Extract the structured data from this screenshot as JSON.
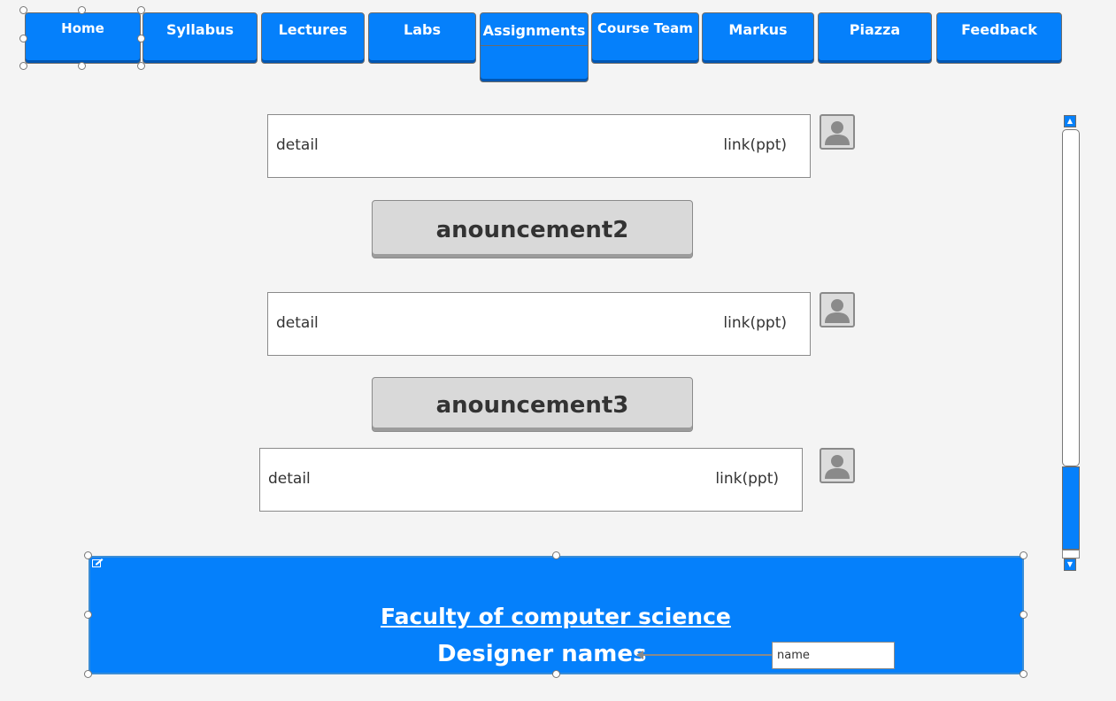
{
  "nav": {
    "items": [
      {
        "label": "Home"
      },
      {
        "label": "Syllabus"
      },
      {
        "label": "Lectures"
      },
      {
        "label": "Labs"
      },
      {
        "label": "Assignments"
      },
      {
        "label": "Course Team"
      },
      {
        "label": "Markus"
      },
      {
        "label": "Piazza"
      },
      {
        "label": "Feedback"
      }
    ],
    "active": "Assignments"
  },
  "announcements": [
    {
      "title": "",
      "detail": "detail",
      "link": "link(ppt)"
    },
    {
      "title": "anouncement2",
      "detail": "detail",
      "link": "link(ppt)"
    },
    {
      "title": "anouncement3",
      "detail": "detail",
      "link": "link(ppt)"
    }
  ],
  "icons": {
    "avatar": "user-avatar-icon",
    "scroll_up": "arrow-up-icon",
    "scroll_down": "arrow-down-icon",
    "edit": "edit-icon"
  },
  "footer": {
    "faculty_link": "Faculty of computer science",
    "designers": "Designer names",
    "name_field_value": "name"
  },
  "colors": {
    "primary": "#0580fb",
    "background": "#f4f4f4",
    "announcement_button": "#d9d9d9",
    "border": "#8a8a8a"
  }
}
